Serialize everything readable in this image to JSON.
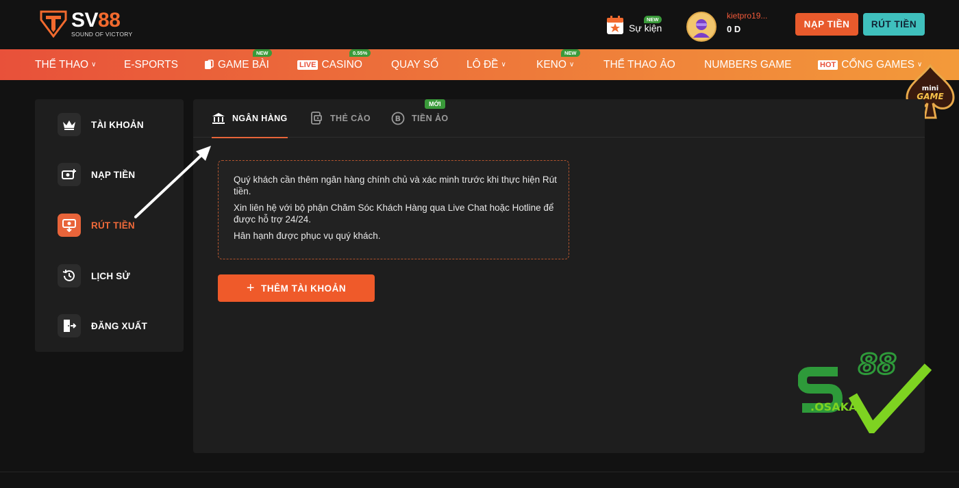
{
  "brand": {
    "name_sv": "SV",
    "name_88": "88",
    "tagline": "SOUND OF VICTORY"
  },
  "header": {
    "event_label": "Sự kiện",
    "event_badge": "NEW",
    "username": "kietpro19...",
    "balance": "0 D",
    "deposit_button": "NẠP TIỀN",
    "withdraw_button": "RÚT TIỀN"
  },
  "nav": {
    "items": [
      {
        "label": "THỂ THAO"
      },
      {
        "label": "E-SPORTS"
      },
      {
        "label": "GAME BÀI",
        "badge": "NEW"
      },
      {
        "label": "CASINO",
        "prefix": "LIVE",
        "badge": "0.55%"
      },
      {
        "label": "QUAY SỐ"
      },
      {
        "label": "LÔ ĐỀ"
      },
      {
        "label": "KENO",
        "badge": "NEW"
      },
      {
        "label": "THỂ THAO ẢO"
      },
      {
        "label": "NUMBERS GAME"
      },
      {
        "label": "CỔNG GAMES",
        "prefix": "HOT"
      }
    ]
  },
  "mini_game": {
    "line1": "mini",
    "line2": "GAME"
  },
  "sidebar": {
    "items": [
      {
        "label": "TÀI KHOẢN",
        "icon": "crown-icon"
      },
      {
        "label": "NẠP TIỀN",
        "icon": "deposit-icon"
      },
      {
        "label": "RÚT TIỀN",
        "icon": "withdraw-icon",
        "active": true
      },
      {
        "label": "LỊCH SỬ",
        "icon": "history-icon"
      },
      {
        "label": "ĐĂNG XUẤT",
        "icon": "logout-icon"
      }
    ]
  },
  "tabs": {
    "items": [
      {
        "label": "NGÂN HÀNG",
        "icon": "bank-icon",
        "active": true
      },
      {
        "label": "THẺ CÀO",
        "icon": "card-icon"
      },
      {
        "label": "TIỀN ẢO",
        "icon": "bitcoin-icon"
      }
    ],
    "new_badge": "MỚI"
  },
  "notice": {
    "line1": "Quý khách cần thêm ngân hàng chính chủ và xác minh trước khi thực hiện Rút tiền.",
    "line2": "Xin liên hệ với bộ phận Chăm Sóc Khách Hàng qua Live Chat hoặc Hotline để được hỗ trợ 24/24.",
    "line3": "Hân hạnh được phục vụ quý khách."
  },
  "add_account_button": "THÊM TÀI KHOẢN",
  "watermark": {
    "num": "88",
    "text": ".OSAKA"
  },
  "colors": {
    "accent": "#e8643a",
    "teal": "#3fc0bd",
    "background": "#121212",
    "panel": "#1e1e1e",
    "green_badge": "#3a9a3a"
  }
}
